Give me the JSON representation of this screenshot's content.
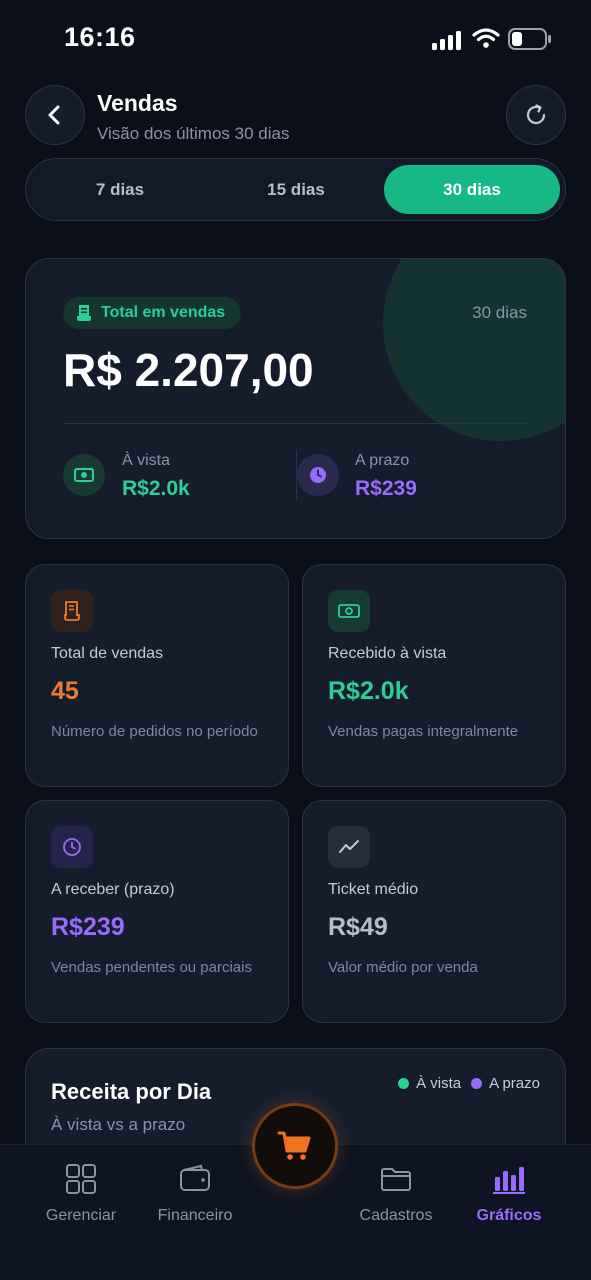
{
  "status_bar": {
    "time": "16:16"
  },
  "header": {
    "title": "Vendas",
    "subtitle": "Visão dos últimos 30 dias"
  },
  "period_tabs": [
    {
      "label": "7 dias",
      "selected": false
    },
    {
      "label": "15 dias",
      "selected": false
    },
    {
      "label": "30 dias",
      "selected": true
    }
  ],
  "summary": {
    "badge_label": "Total em vendas",
    "period_label": "30 dias",
    "total": "R$ 2.207,00",
    "cash": {
      "label": "À vista",
      "value": "R$2.0k"
    },
    "credit": {
      "label": "A prazo",
      "value": "R$239"
    }
  },
  "stats": [
    {
      "label": "Total de vendas",
      "value": "45",
      "description": "Número de pedidos no período",
      "color": "#ee7a2e"
    },
    {
      "label": "Recebido à vista",
      "value": "R$2.0k",
      "description": "Vendas pagas integralmente",
      "color": "#2ccf97"
    },
    {
      "label": "A receber (prazo)",
      "value": "R$239",
      "description": "Vendas pendentes ou parciais",
      "color": "#9a6bff"
    },
    {
      "label": "Ticket médio",
      "value": "R$49",
      "description": "Valor médio por venda",
      "color": "#b7bdcc"
    }
  ],
  "revenue_chart": {
    "title": "Receita por Dia",
    "subtitle": "À vista vs a prazo",
    "legend": [
      {
        "label": "À vista",
        "color": "#2ccf97"
      },
      {
        "label": "A prazo",
        "color": "#9a6bff"
      }
    ]
  },
  "tab_bar": [
    {
      "label": "Gerenciar",
      "active": false
    },
    {
      "label": "Financeiro",
      "active": false
    },
    {
      "label": "Cadastros",
      "active": false
    },
    {
      "label": "Gráficos",
      "active": true
    }
  ],
  "colors": {
    "accent_green": "#16b886",
    "accent_purple": "#9a6bff",
    "accent_orange": "#ee7a2e"
  }
}
